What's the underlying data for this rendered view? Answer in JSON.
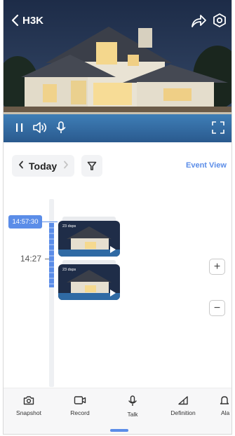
{
  "header": {
    "title": "H3K"
  },
  "date_nav": {
    "day_label": "Today",
    "event_view_label": "Event View"
  },
  "timeline": {
    "current_time": "14:57:30",
    "hour_label": "14:27",
    "clips": [
      {
        "stamp": "23 dsps"
      },
      {
        "stamp": "23 dsps"
      }
    ]
  },
  "zoom": {
    "in_label": "+",
    "out_label": "−"
  },
  "toolbar": {
    "items": [
      {
        "label": "Snapshot",
        "icon": "camera-icon"
      },
      {
        "label": "Record",
        "icon": "video-record-icon"
      },
      {
        "label": "Talk",
        "icon": "microphone-icon"
      },
      {
        "label": "Definition",
        "icon": "definition-icon"
      },
      {
        "label": "Ala",
        "icon": "alarm-bell-icon"
      }
    ]
  },
  "colors": {
    "accent": "#5b8de8",
    "background": "#ffffff",
    "pill": "#f2f3f5"
  }
}
